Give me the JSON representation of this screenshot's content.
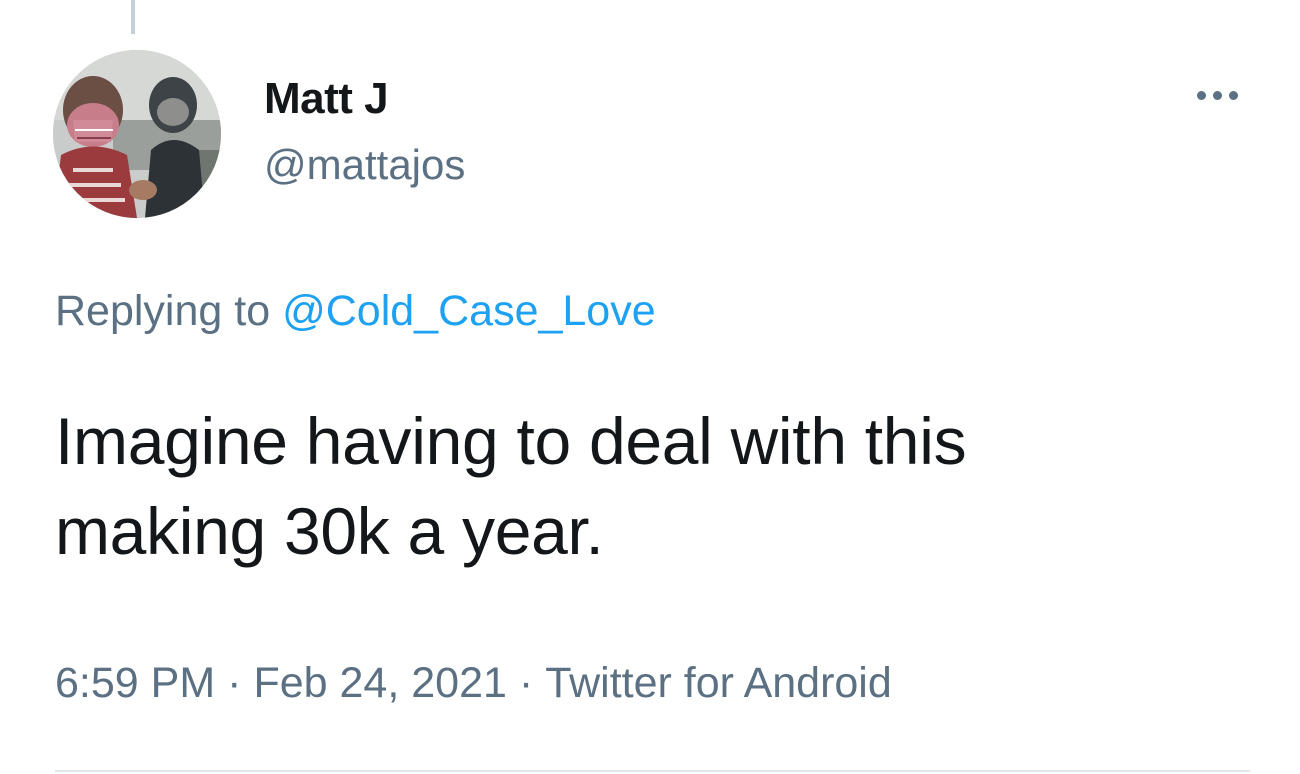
{
  "tweet": {
    "author": {
      "display_name": "Matt J",
      "handle": "@mattajos"
    },
    "more_icon": "more-horizontal-icon",
    "reply_context": {
      "prefix": "Replying to",
      "mention": "@Cold_Case_Love"
    },
    "text_line_1": "Imagine having to deal with this",
    "text_line_2": "making 30k a year.",
    "meta": {
      "time": "6:59 PM",
      "separator": "·",
      "date": "Feb 24, 2021",
      "source": "Twitter for Android"
    }
  },
  "colors": {
    "primary_text": "#14171a",
    "secondary_text": "#5b7083",
    "link": "#1da1f2",
    "divider": "#e1e8ed"
  }
}
